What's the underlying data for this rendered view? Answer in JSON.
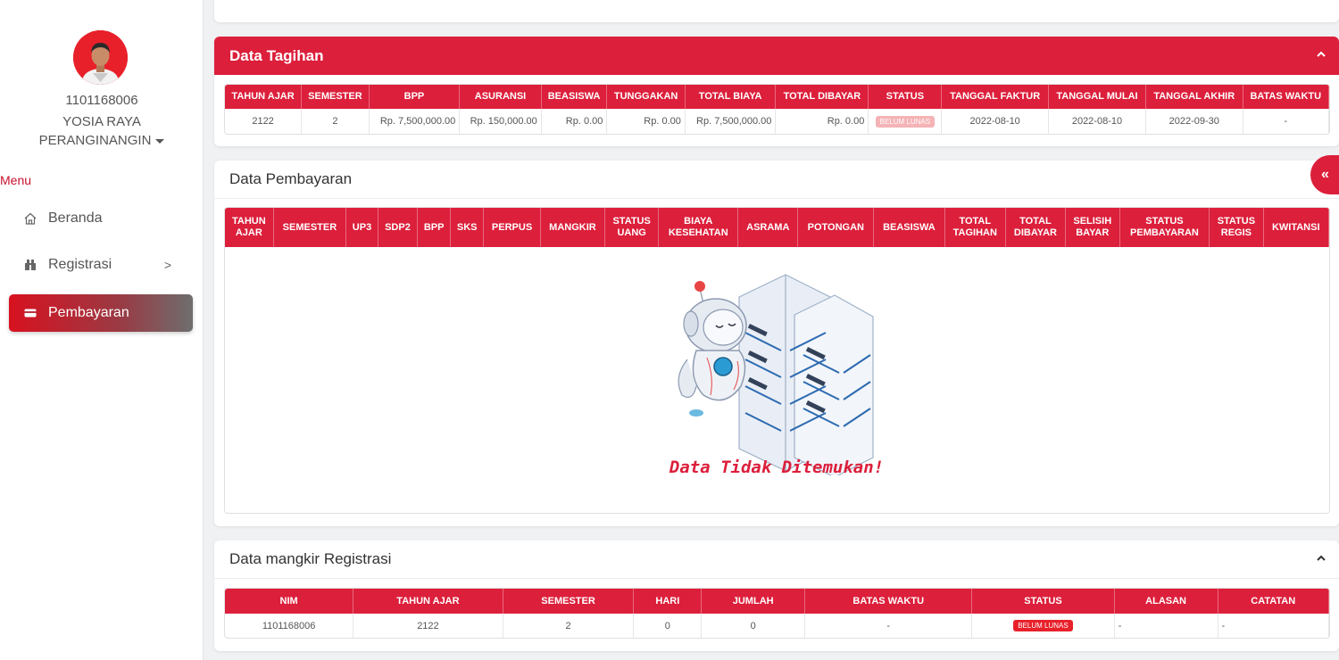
{
  "user": {
    "id": "1101168006",
    "name_line1": "YOSIA RAYA",
    "name_line2": "PERANGINANGIN"
  },
  "menu": {
    "label": "Menu",
    "items": [
      {
        "label": "Beranda",
        "icon": "home-icon"
      },
      {
        "label": "Registrasi",
        "icon": "registration-icon",
        "arrow": ">"
      },
      {
        "label": "Pembayaran",
        "icon": "card-icon",
        "active": true
      }
    ]
  },
  "tagihan": {
    "title": "Data Tagihan",
    "headers": [
      "TAHUN AJAR",
      "SEMESTER",
      "BPP",
      "ASURANSI",
      "BEASISWA",
      "TUNGGAKAN",
      "TOTAL BIAYA",
      "TOTAL DIBAYAR",
      "STATUS",
      "TANGGAL FAKTUR",
      "TANGGAL MULAI",
      "TANGGAL AKHIR",
      "BATAS WAKTU"
    ],
    "row": [
      "2122",
      "2",
      "Rp. 7,500,000.00",
      "Rp. 150,000.00",
      "Rp. 0.00",
      "Rp. 0.00",
      "Rp. 7,500,000.00",
      "Rp. 0.00",
      "BELUM LUNAS",
      "2022-08-10",
      "2022-08-10",
      "2022-09-30",
      "-"
    ]
  },
  "pembayaran": {
    "title": "Data Pembayaran",
    "headers": [
      [
        "TAHUN",
        "AJAR"
      ],
      [
        "SEMESTER"
      ],
      [
        "UP3"
      ],
      [
        "SDP2"
      ],
      [
        "BPP"
      ],
      [
        "SKS"
      ],
      [
        "PERPUS"
      ],
      [
        "MANGKIR"
      ],
      [
        "STATUS",
        "UANG"
      ],
      [
        "BIAYA",
        "KESEHATAN"
      ],
      [
        "ASRAMA"
      ],
      [
        "POTONGAN"
      ],
      [
        "BEASISWA"
      ],
      [
        "TOTAL",
        "TAGIHAN"
      ],
      [
        "TOTAL",
        "DIBAYAR"
      ],
      [
        "SELISIH",
        "BAYAR"
      ],
      [
        "STATUS",
        "PEMBAYARAN"
      ],
      [
        "STATUS",
        "REGIS"
      ],
      [
        "KWITANSI"
      ]
    ],
    "empty_message": "Data Tidak Ditemukan!"
  },
  "mangkir": {
    "title": "Data mangkir Registrasi",
    "headers": [
      "NIM",
      "TAHUN AJAR",
      "SEMESTER",
      "HARI",
      "JUMLAH",
      "BATAS WAKTU",
      "STATUS",
      "ALASAN",
      "CATATAN"
    ],
    "row": [
      "1101168006",
      "2122",
      "2",
      "0",
      "0",
      "-",
      "BELUM LUNAS",
      "-",
      "-"
    ]
  },
  "side_toggle": "«",
  "colors": {
    "accent": "#dc1f3b"
  }
}
